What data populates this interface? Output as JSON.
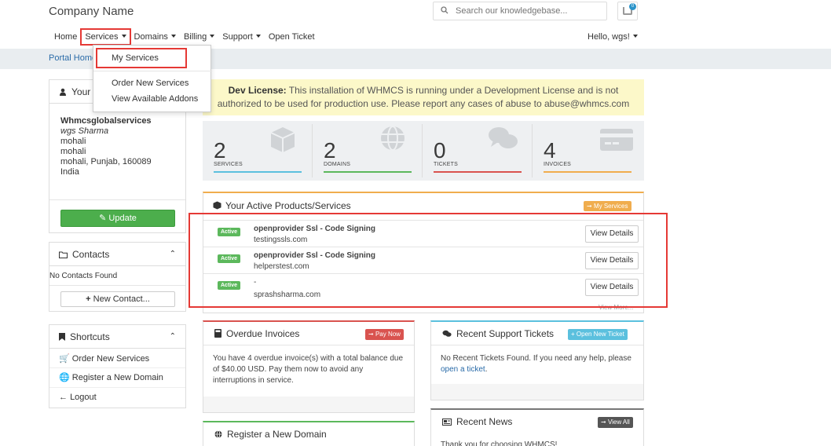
{
  "header": {
    "brand": "Company Name",
    "search_placeholder": "Search our knowledgebase...",
    "cart_count": "0",
    "greeting": "Hello, wgs!"
  },
  "nav": {
    "home": "Home",
    "services": "Services",
    "domains": "Domains",
    "billing": "Billing",
    "support": "Support",
    "open_ticket": "Open Ticket"
  },
  "dropdown": {
    "items": [
      "My Services",
      "Order New Services",
      "View Available Addons"
    ]
  },
  "breadcrumb": "Portal Home",
  "info_panel": {
    "title": "Your",
    "company": "Whmcsglobalservices",
    "name": "wgs Sharma",
    "line1": "mohali",
    "line2": "mohali",
    "line3": "mohali, Punjab, 160089",
    "country": "India",
    "update_label": "Update"
  },
  "contacts_panel": {
    "title": "Contacts",
    "empty_text": "No Contacts Found",
    "new_label": "New Contact..."
  },
  "shortcuts_panel": {
    "title": "Shortcuts",
    "items": [
      "Order New Services",
      "Register a New Domain",
      "Logout"
    ]
  },
  "alert": {
    "strong": "Dev License:",
    "text1": " This installation of WHMCS is running under a Development License and is not",
    "text2": "authorized to be used for production use. Please report any cases of abuse to abuse@whmcs.com"
  },
  "stats": [
    {
      "value": "2",
      "label": "SERVICES",
      "color": "#5bc0de"
    },
    {
      "value": "2",
      "label": "DOMAINS",
      "color": "#5cb85c"
    },
    {
      "value": "0",
      "label": "TICKETS",
      "color": "#d9534f"
    },
    {
      "value": "4",
      "label": "INVOICES",
      "color": "#f0ad4e"
    }
  ],
  "products": {
    "title": "Your Active Products/Services",
    "my_services_label": "My Services",
    "status_label": "Active",
    "view_details": "View Details",
    "view_more": "View More...",
    "rows": [
      {
        "name": "openprovider Ssl - Code Signing",
        "domain": "testingssls.com"
      },
      {
        "name": "openprovider Ssl - Code Signing",
        "domain": "helperstest.com"
      },
      {
        "name": "-",
        "domain": "sprashsharma.com"
      }
    ]
  },
  "overdue": {
    "title": "Overdue Invoices",
    "button": "Pay Now",
    "text": "You have 4 overdue invoice(s) with a total balance due of $40.00 USD. Pay them now to avoid any interruptions in service."
  },
  "tickets": {
    "title": "Recent Support Tickets",
    "button": "Open New Ticket",
    "text": "No Recent Tickets Found. If you need any help, please",
    "link": "open a ticket",
    "period": "."
  },
  "register": {
    "title": "Register a New Domain"
  },
  "news": {
    "title": "Recent News",
    "button": "View All",
    "text": "Thank you for choosing WHMCS!"
  },
  "colors": {
    "highlight": "#e53935",
    "accent_link": "#2a6ba8",
    "success": "#5cb85c",
    "warning": "#f0ad4e",
    "danger": "#d9534f",
    "info": "#5bc0de"
  }
}
